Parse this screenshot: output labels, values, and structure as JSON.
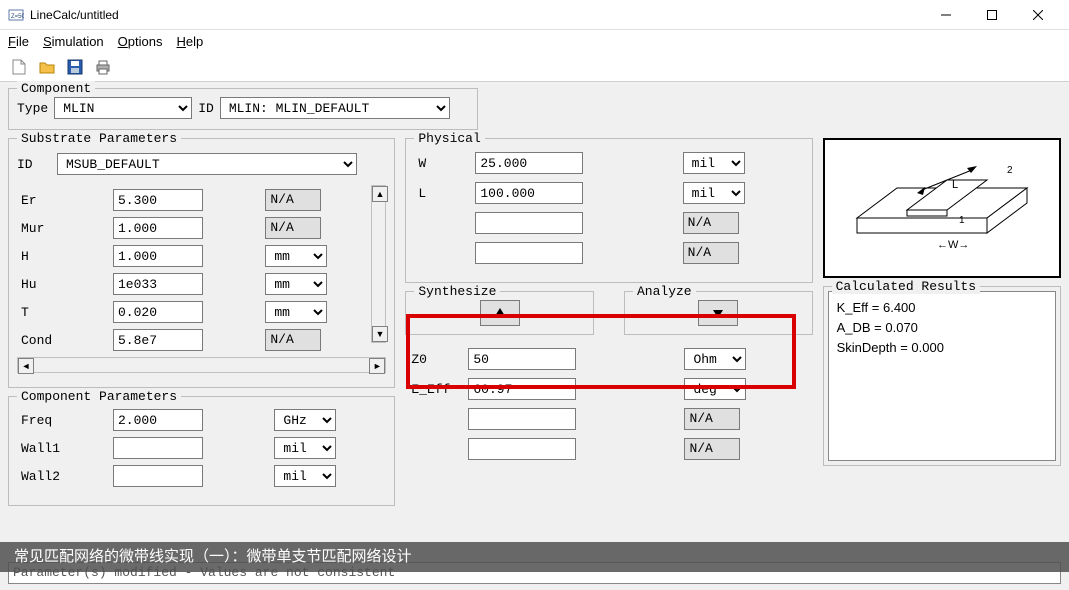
{
  "window": {
    "title": "LineCalc/untitled"
  },
  "menu": {
    "file": "File",
    "simulation": "Simulation",
    "options": "Options",
    "help": "Help"
  },
  "component": {
    "legend": "Component",
    "type_label": "Type",
    "type_value": "MLIN",
    "id_label": "ID",
    "id_value": "MLIN: MLIN_DEFAULT"
  },
  "substrate": {
    "legend": "Substrate Parameters",
    "id_label": "ID",
    "id_value": "MSUB_DEFAULT",
    "rows": [
      {
        "name": "Er",
        "value": "5.300",
        "unit": "N/A",
        "unit_disabled": true
      },
      {
        "name": "Mur",
        "value": "1.000",
        "unit": "N/A",
        "unit_disabled": true
      },
      {
        "name": "H",
        "value": "1.000",
        "unit": "mm",
        "unit_disabled": false
      },
      {
        "name": "Hu",
        "value": "1e033",
        "unit": "mm",
        "unit_disabled": false
      },
      {
        "name": "T",
        "value": "0.020",
        "unit": "mm",
        "unit_disabled": false
      },
      {
        "name": "Cond",
        "value": "5.8e7",
        "unit": "N/A",
        "unit_disabled": true
      }
    ]
  },
  "comp_params": {
    "legend": "Component Parameters",
    "rows": [
      {
        "name": "Freq",
        "value": "2.000",
        "unit": "GHz"
      },
      {
        "name": "Wall1",
        "value": "",
        "unit": "mil"
      },
      {
        "name": "Wall2",
        "value": "",
        "unit": "mil"
      }
    ]
  },
  "physical": {
    "legend": "Physical",
    "rows": [
      {
        "name": "W",
        "value": "25.000",
        "unit": "mil"
      },
      {
        "name": "L",
        "value": "100.000",
        "unit": "mil"
      },
      {
        "name": "",
        "value": "",
        "unit": "N/A",
        "disabled": true
      },
      {
        "name": "",
        "value": "",
        "unit": "N/A",
        "disabled": true
      }
    ]
  },
  "synthesize_label": "Synthesize",
  "analyze_label": "Analyze",
  "electrical": {
    "rows": [
      {
        "name": "Z0",
        "value": "50",
        "unit": "Ohm"
      },
      {
        "name": "E_Eff",
        "value": "60.97",
        "unit": "deg"
      },
      {
        "name": "",
        "value": "",
        "unit": "N/A",
        "disabled": true
      },
      {
        "name": "",
        "value": "",
        "unit": "N/A",
        "disabled": true
      }
    ]
  },
  "results": {
    "legend": "Calculated Results",
    "lines": [
      "K_Eff = 6.400",
      "A_DB = 0.070",
      "SkinDepth = 0.000"
    ]
  },
  "status": "Parameter(s) modified - Values are not consistent",
  "overlay": "常见匹配网络的微带线实现（一）：微带单支节匹配网络设计",
  "diagram_labels": {
    "L": "L",
    "W": "W",
    "one": "1",
    "two": "2"
  }
}
